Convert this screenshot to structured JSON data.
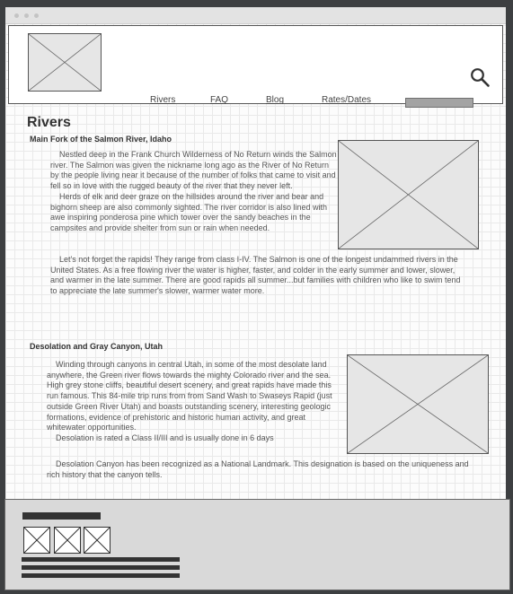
{
  "nav": {
    "items": [
      {
        "label": "Rivers"
      },
      {
        "label": "FAQ"
      },
      {
        "label": "Blog"
      },
      {
        "label": "Rates/Dates"
      }
    ],
    "search_icon": "magnifier-icon"
  },
  "page": {
    "title": "Rivers"
  },
  "sections": [
    {
      "heading": "Main Fork of the Salmon River, Idaho",
      "paragraphs": [
        "Nestled deep in the Frank Church Wilderness of No Return winds the Salmon river. The Salmon was given the nickname long ago as the River of No Return by the people living near it because of the number of folks that came to visit and fell so in love with the rugged beauty of the river that they never left.",
        "Herds of elk and deer graze on the hillsides around the river and bear and bighorn sheep are also commonly sighted. The river corridor is also lined with awe inspiring ponderosa pine which tower over the sandy beaches in the campsites and provide shelter from sun or rain when needed.",
        "Let's not forget the rapids! They range from class I-IV. The Salmon is one of the longest undammed rivers in the United States. As a free flowing river the water is higher, faster, and colder in the early summer and lower, slower, and warmer in the late summer. There are good rapids all summer...but families with children who like to swim tend to appreciate the late summer's slower, warmer water more."
      ]
    },
    {
      "heading": "Desolation and Gray Canyon, Utah",
      "paragraphs": [
        "Winding through canyons in central Utah, in some of the most desolate land anywhere, the Green river flows towards the mighty Colorado river and the sea. High grey stone cliffs, beautiful desert scenery, and great rapids have made this run famous. This 84-mile trip runs from from Sand Wash to Swaseys Rapid (just outside Green River Utah) and boasts outstanding scenery, interesting geologic formations, evidence of prehistoric and historic human activity, and great whitewater opportunities.",
        "Desolation is rated a Class II/III and is usually done in 6 days",
        "Desolation Canyon has been recognized as a National Landmark. This designation is based on the uniqueness and rich history that the canyon tells."
      ]
    }
  ]
}
